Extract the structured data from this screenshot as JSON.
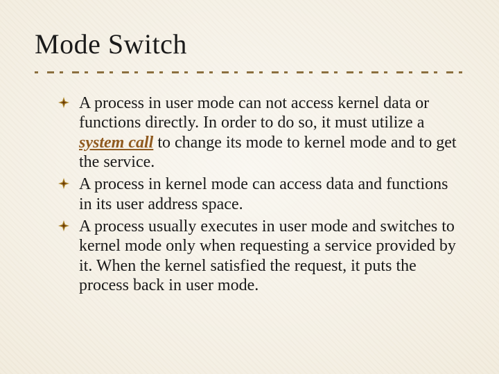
{
  "title": "Mode Switch",
  "bullets": [
    {
      "pre": "A process in user mode can not access kernel data or functions directly. In order to do so, it must utilize a ",
      "emph": "system call",
      "post": " to change its mode to kernel mode and to get the service."
    },
    {
      "pre": "A process in kernel mode can access data and functions in its user address space.",
      "emph": "",
      "post": ""
    },
    {
      "pre": "A process usually executes in user mode and switches to kernel mode only when requesting a service provided by it. When the kernel satisfied the request, it puts the process  back in user mode.",
      "emph": "",
      "post": ""
    }
  ]
}
